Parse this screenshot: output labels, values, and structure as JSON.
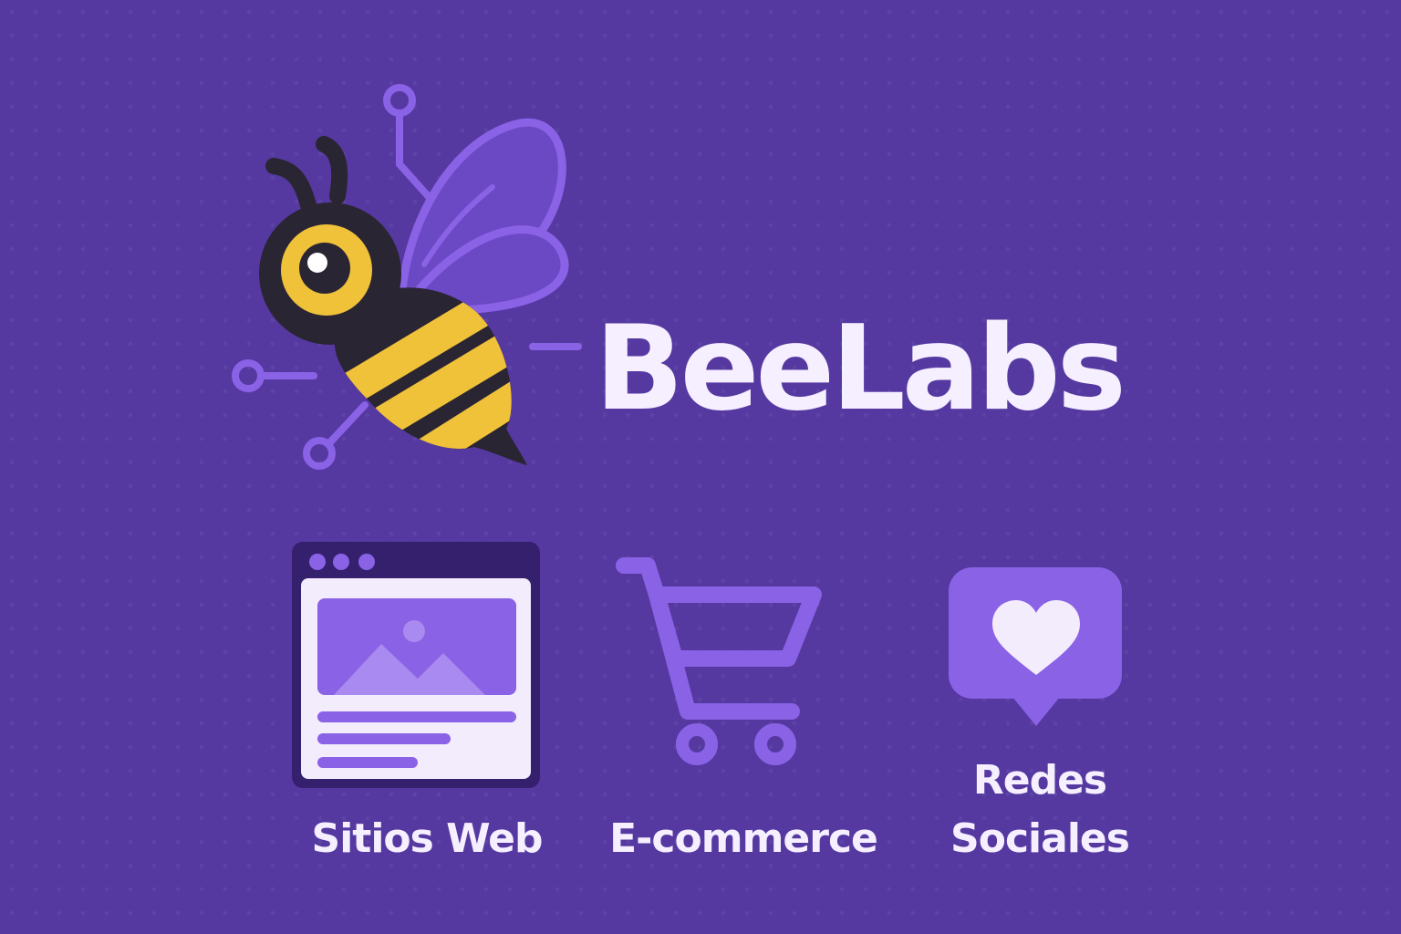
{
  "brand": {
    "name": "BeeLabs",
    "logo_icon": "bee-circuit-icon"
  },
  "colors": {
    "background": "#5539A1",
    "text": "#F5EFFF",
    "accent_purple": "#8A62E6",
    "bee_yellow": "#F0C23A",
    "bee_dark": "#2A2533"
  },
  "services": [
    {
      "icon": "browser-window-icon",
      "label": "Sitios Web"
    },
    {
      "icon": "shopping-cart-icon",
      "label": "E-commerce"
    },
    {
      "icon": "heart-chat-bubble-icon",
      "label_line1": "Redes",
      "label_line2": "Sociales"
    }
  ]
}
